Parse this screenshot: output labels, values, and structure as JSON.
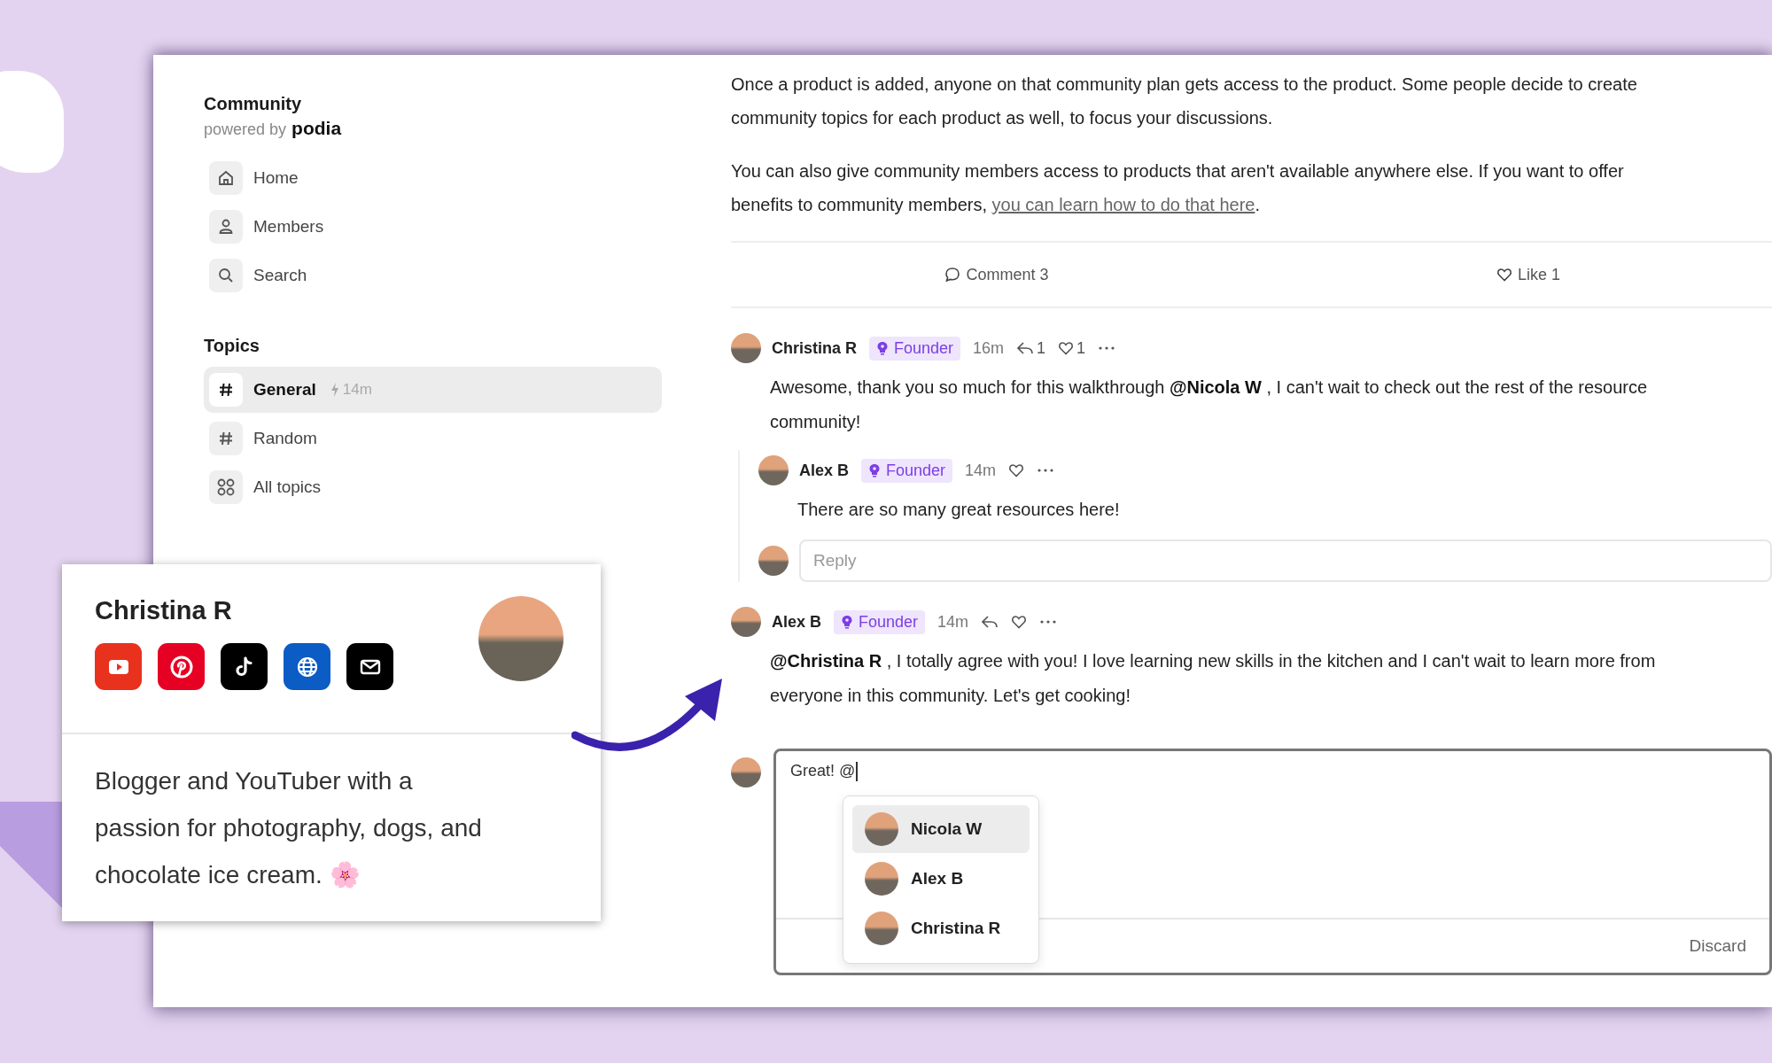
{
  "sidebar": {
    "title": "Community",
    "powered_by": "powered by",
    "brand": "podia",
    "nav": [
      {
        "label": "Home",
        "kind": "home"
      },
      {
        "label": "Members",
        "kind": "members"
      },
      {
        "label": "Search",
        "kind": "search"
      }
    ],
    "topics_heading": "Topics",
    "topics": [
      {
        "label": "General",
        "kind": "hash",
        "selected": true,
        "activity": "14m"
      },
      {
        "label": "Random",
        "kind": "hash",
        "selected": false
      },
      {
        "label": "All topics",
        "kind": "grid",
        "selected": false
      }
    ]
  },
  "post": {
    "paragraphs": [
      {
        "lines": [
          "Once a product is added, anyone on that community plan gets access to the product. Some people decide to create",
          "community topics for each product as well, to focus your discussions."
        ]
      },
      {
        "lines": [
          "You can also give community members access to products that aren't available anywhere else. If you want to offer",
          "benefits to community members, "
        ],
        "link": "you can learn how to do that here",
        "after": "."
      }
    ],
    "comment_action": "Comment 3",
    "like_action": "Like 1"
  },
  "comments": [
    {
      "author": "Christina R",
      "badge": "Founder",
      "time": "16m",
      "reply_count": "1",
      "like_count": "1",
      "lines": [
        "Awesome, thank you so much for this walkthrough **@Nicola W** , I can't wait to check out the rest of the resource",
        "community!"
      ],
      "replies": [
        {
          "author": "Alex B",
          "badge": "Founder",
          "time": "14m",
          "lines": [
            "There are so many great resources here!"
          ]
        }
      ],
      "reply_placeholder": "Reply"
    },
    {
      "author": "Alex B",
      "badge": "Founder",
      "time": "14m",
      "lines": [
        "**@Christina R** , I totally agree with you! I love learning new skills in the kitchen and I can't wait to learn more from",
        "everyone in this community. Let's get cooking!"
      ]
    }
  ],
  "composer": {
    "value": "Great! @",
    "mentions": [
      {
        "name": "Nicola W",
        "selected": true
      },
      {
        "name": "Alex B",
        "selected": false
      },
      {
        "name": "Christina R",
        "selected": false
      }
    ],
    "discard": "Discard"
  },
  "profile_card": {
    "name": "Christina R",
    "socials": [
      {
        "kind": "youtube"
      },
      {
        "kind": "pinterest"
      },
      {
        "kind": "tiktok"
      },
      {
        "kind": "web"
      },
      {
        "kind": "email"
      }
    ],
    "bio": [
      "Blogger and YouTuber with a",
      "passion for photography, dogs, and",
      "chocolate ice cream. 🌸"
    ]
  }
}
